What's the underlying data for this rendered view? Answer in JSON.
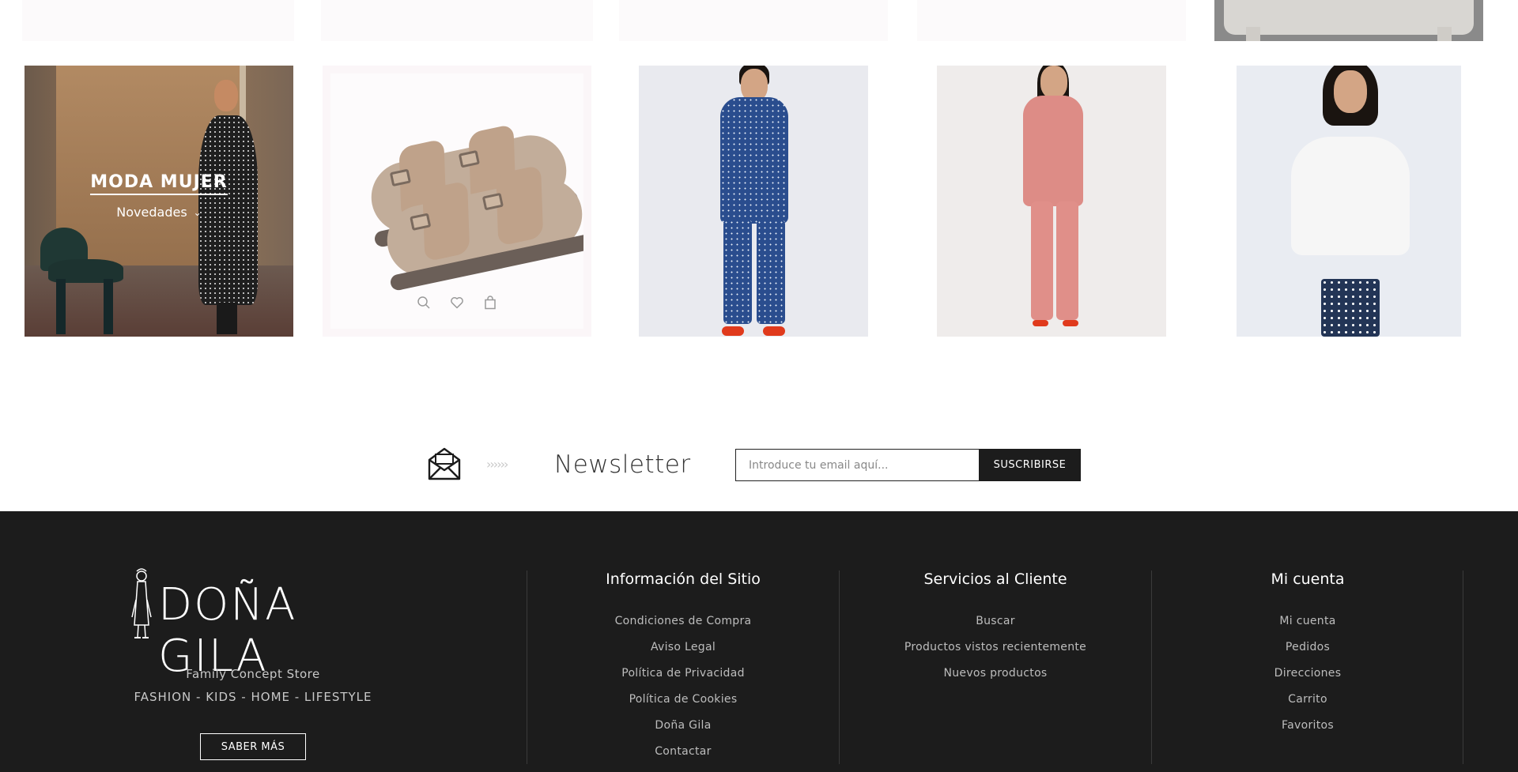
{
  "banner": {
    "title": "MODA MUJER",
    "dropdown_label": "Novedades"
  },
  "product_icons": [
    "search-icon",
    "heart-icon",
    "bag-icon"
  ],
  "newsletter": {
    "arrows": "››››››",
    "title": "Newsletter",
    "input_placeholder": "Introduce tu email aquí...",
    "button_label": "SUSCRIBIRSE"
  },
  "footer": {
    "brand": {
      "logo_text": "DOÑA GILA",
      "tagline": "Family Concept Store",
      "categories": "FASHION - KIDS - HOME - LIFESTYLE",
      "button_label": "SABER MÁS"
    },
    "columns": [
      {
        "title": "Información del Sitio",
        "links": [
          "Condiciones de Compra",
          "Aviso Legal",
          "Política de Privacidad",
          "Política de Cookies",
          "Doña Gila",
          "Contactar"
        ]
      },
      {
        "title": "Servicios al Cliente",
        "links": [
          "Buscar",
          "Productos vistos recientemente",
          "Nuevos productos"
        ]
      },
      {
        "title": "Mi cuenta",
        "links": [
          "Mi cuenta",
          "Pedidos",
          "Direcciones",
          "Carrito",
          "Favoritos"
        ]
      }
    ]
  },
  "colors": {
    "footer_bg": "#1c1c1c",
    "button_dark": "#1c1c1c",
    "page_bg": "#ffffff"
  }
}
